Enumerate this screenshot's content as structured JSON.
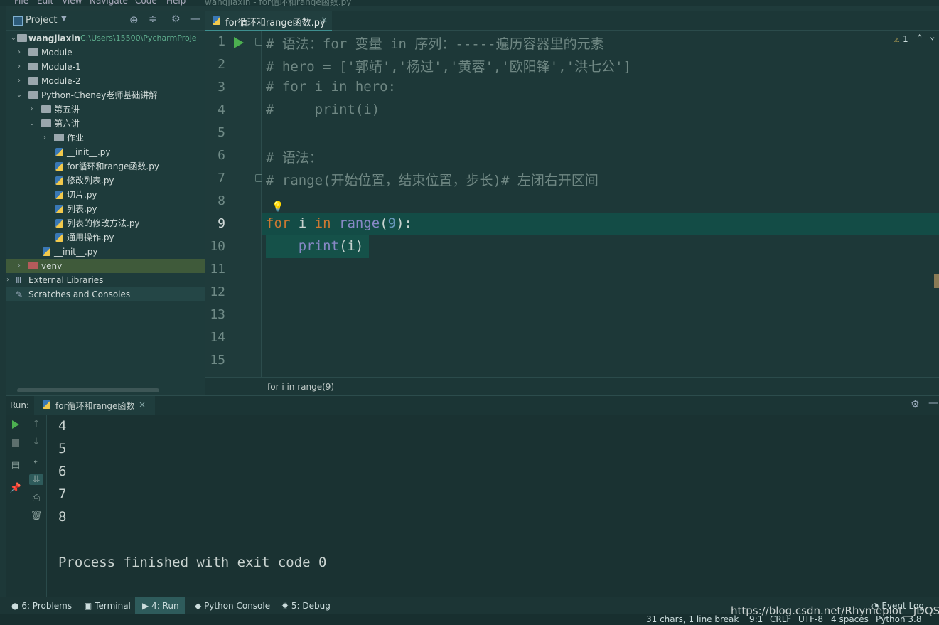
{
  "window": {
    "menu": [
      "File",
      "Edit",
      "View",
      "Navigate",
      "Code",
      "Help"
    ],
    "title": "wangjiaxin - for循环和range函数.py"
  },
  "project": {
    "header_label": "Project",
    "root": {
      "name": "wangjiaxin",
      "path": "C:\\Users\\15500\\PycharmProje"
    },
    "items": [
      {
        "label": "Module"
      },
      {
        "label": "Module-1"
      },
      {
        "label": "Module-2"
      },
      {
        "label": "Python-Cheney老师基础讲解"
      },
      {
        "label": "第五讲"
      },
      {
        "label": "第六讲"
      },
      {
        "label": "作业"
      },
      {
        "label": "__init__.py"
      },
      {
        "label": "for循环和range函数.py"
      },
      {
        "label": "修改列表.py"
      },
      {
        "label": "切片.py"
      },
      {
        "label": "列表.py"
      },
      {
        "label": "列表的修改方法.py"
      },
      {
        "label": "通用操作.py"
      },
      {
        "label": "__init__.py"
      },
      {
        "label": "venv"
      },
      {
        "label": "External Libraries"
      },
      {
        "label": "Scratches and Consoles"
      }
    ]
  },
  "editor": {
    "tab_label": "for循环和range函数.py",
    "warning_count": "1",
    "line_numbers": [
      "1",
      "2",
      "3",
      "4",
      "5",
      "6",
      "7",
      "8",
      "9",
      "10",
      "11",
      "12",
      "13",
      "14",
      "15"
    ],
    "lines": [
      "# 语法：for 变量 in 序列：-----遍历容器里的元素",
      "# hero = ['郭靖','杨过','黄蓉','欧阳锋','洪七公']",
      "# for i in hero:",
      "#     print(i)",
      "",
      "# 语法：",
      "# range(开始位置，结束位置，步长)# 左闭右开区间",
      "",
      "for i in range(9):",
      "    print(i)"
    ],
    "code9": {
      "kw1": "for",
      "var": " i ",
      "kw2": "in",
      "sp": " ",
      "fn": "range",
      "p1": "(",
      "num": "9",
      "p2": "):"
    },
    "code10": {
      "indent": "    ",
      "fn": "print",
      "rest": "(i)"
    },
    "breadcrumb": "for i in range(9)"
  },
  "run": {
    "label": "Run:",
    "tab_label": "for循环和range函数",
    "output": [
      "4",
      "5",
      "6",
      "7",
      "8",
      "",
      "Process finished with exit code 0"
    ]
  },
  "toolbar": {
    "problems": "6: Problems",
    "terminal": "Terminal",
    "run": "4: Run",
    "python_console": "Python Console",
    "debug": "5: Debug",
    "event_log": "Event Log"
  },
  "status": {
    "chars": "31 chars, 1 line break",
    "position": "9:1",
    "line_sep": "CRLF",
    "encoding": "UTF-8",
    "indent": "4 spaces",
    "interpreter": "Python 3.8"
  },
  "watermark": "https://blog.csdn.net/Rhymeplot__JDQS",
  "colors": {
    "keyword": "#cc7832",
    "builtin": "#8888c6",
    "number": "#6897bb",
    "comment": "#6f8783",
    "background": "#1d3838"
  }
}
